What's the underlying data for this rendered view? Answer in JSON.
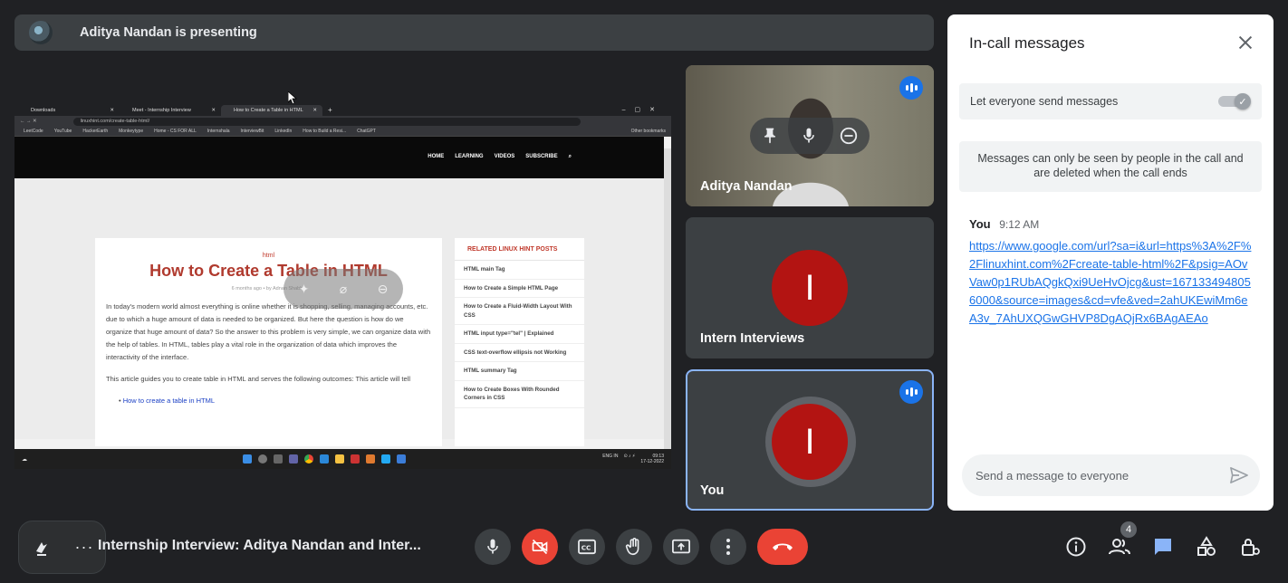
{
  "presenting_bar": {
    "text": "Aditya Nandan is presenting"
  },
  "shared_screen": {
    "tabs": [
      {
        "label": "Downloads"
      },
      {
        "label": "Meet - Internship Interview"
      },
      {
        "label": "How to Create a Table in HTML"
      }
    ],
    "url": "linuxhint.com/create-table-html/",
    "bookmarks": [
      "LeetCode",
      "YouTube",
      "HackerEarth",
      "Monkeytype",
      "Home - CS FOR ALL",
      "Internshala",
      "InterviewBit",
      "LinkedIn",
      "How to Build a Resi...",
      "ChatGPT"
    ],
    "other_bookmarks": "Other bookmarks",
    "site_nav": [
      "HOME",
      "LEARNING",
      "VIDEOS",
      "SUBSCRIBE"
    ],
    "article": {
      "kicker": "html",
      "title": "How to Create a Table in HTML",
      "meta": "6 months ago • by Adnan Shabbir",
      "p1": "In today's modern world almost everything is online whether it is shopping, selling, managing accounts, etc. due to which a huge amount of data is needed to be organized. But here the question is how do we organize that huge amount of data? So the answer to this problem is very simple, we can organize data with the help of tables. In HTML, tables play a vital role in the organization of data which improves the interactivity of the interface.",
      "p2": "This article guides you to create table in HTML and serves the following outcomes: This article will tell",
      "li1": "How to create a table in HTML"
    },
    "related": {
      "heading": "RELATED LINUX HINT POSTS",
      "items": [
        "HTML main Tag",
        "How to Create a Simple HTML Page",
        "How to Create a Fluid-Width Layout With CSS",
        "HTML input type=\"tel\" | Explained",
        "CSS text-overflow ellipsis not Working",
        "HTML summary Tag",
        "How to Create Boxes With Rounded Corners in CSS"
      ]
    },
    "taskbar": {
      "lang": "ENG IN",
      "time": "09:13",
      "date": "17-12-2022"
    }
  },
  "tiles": [
    {
      "name": "Aditya Nandan",
      "speaking": true
    },
    {
      "name": "Intern Interviews",
      "initial": "I"
    },
    {
      "name": "You",
      "initial": "I",
      "speaking": true
    }
  ],
  "panel": {
    "title": "In-call messages",
    "allow_label": "Let everyone send messages",
    "allow_on": true,
    "info": "Messages can only be seen by people in the call and are deleted when the call ends",
    "message": {
      "sender": "You",
      "time": "9:12 AM",
      "text": "https://www.google.com/url?sa=i&url=https%3A%2F%2Flinuxhint.com%2Fcreate-table-html%2F&psig=AOvVaw0p1RUbAQgkQxi9UeHvOjcg&ust=1671334948056000&source=images&cd=vfe&ved=2ahUKEwiMm6eA3v_7AhUXQGwGHVP8DgAQjRx6BAgAEAo"
    },
    "input_placeholder": "Send a message to everyone"
  },
  "bottom_bar": {
    "meeting_title": "Internship Interview: Aditya Nandan and Inter...",
    "people_count": "4"
  },
  "colors": {
    "end_call": "#ea4335",
    "accent": "#1a73e8",
    "background": "#202124"
  }
}
